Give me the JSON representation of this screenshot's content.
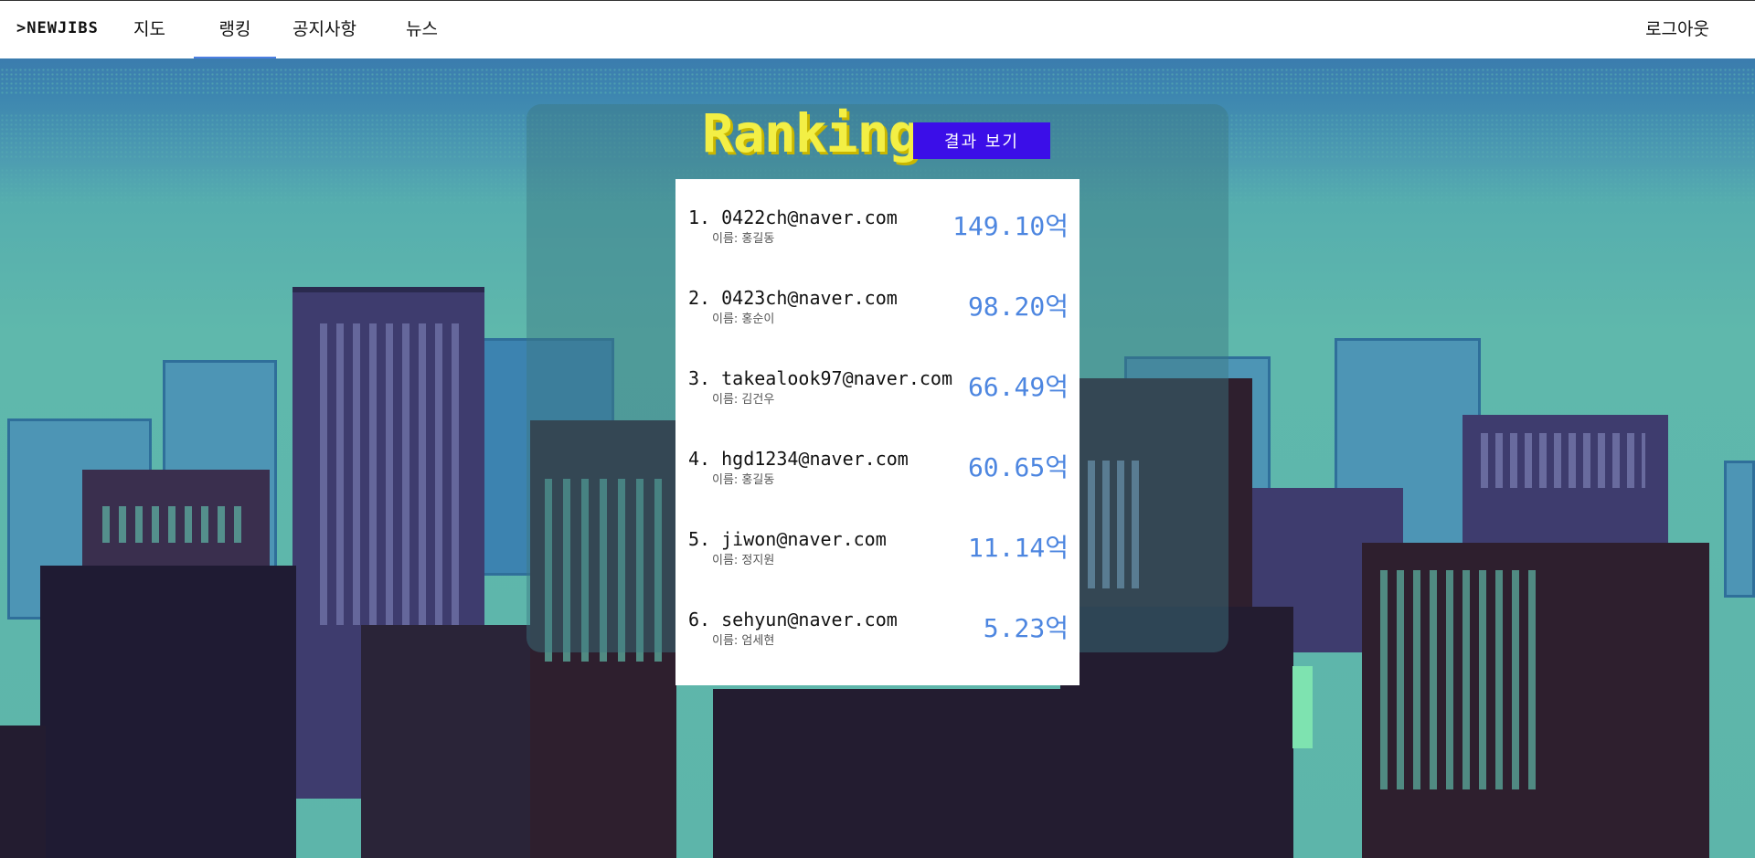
{
  "nav": {
    "logo": ">NEWJIBS",
    "items": [
      {
        "label": "지도"
      },
      {
        "label": "랭킹"
      },
      {
        "label": "공지사항"
      },
      {
        "label": "뉴스"
      }
    ],
    "logout": "로그아웃"
  },
  "ranking": {
    "title": "Ranking",
    "result_button": "결과 보기",
    "entries": [
      {
        "rank_email": "1. 0422ch@naver.com",
        "name": "이름: 홍길동",
        "amount": "149.10억"
      },
      {
        "rank_email": "2. 0423ch@naver.com",
        "name": "이름: 홍순이",
        "amount": "98.20억"
      },
      {
        "rank_email": "3. takealook97@naver.com",
        "name": "이름: 김건우",
        "amount": "66.49억"
      },
      {
        "rank_email": "4. hgd1234@naver.com",
        "name": "이름: 홍길동",
        "amount": "60.65억"
      },
      {
        "rank_email": "5. jiwon@naver.com",
        "name": "이름: 정지원",
        "amount": "11.14억"
      },
      {
        "rank_email": "6. sehyun@naver.com",
        "name": "이름: 엄세현",
        "amount": "5.23억"
      }
    ]
  },
  "colors": {
    "accent": "#3b0ee8",
    "title": "#f3ef45",
    "amount": "#4d86e0",
    "active_tab_underline": "#4d7fe0"
  }
}
